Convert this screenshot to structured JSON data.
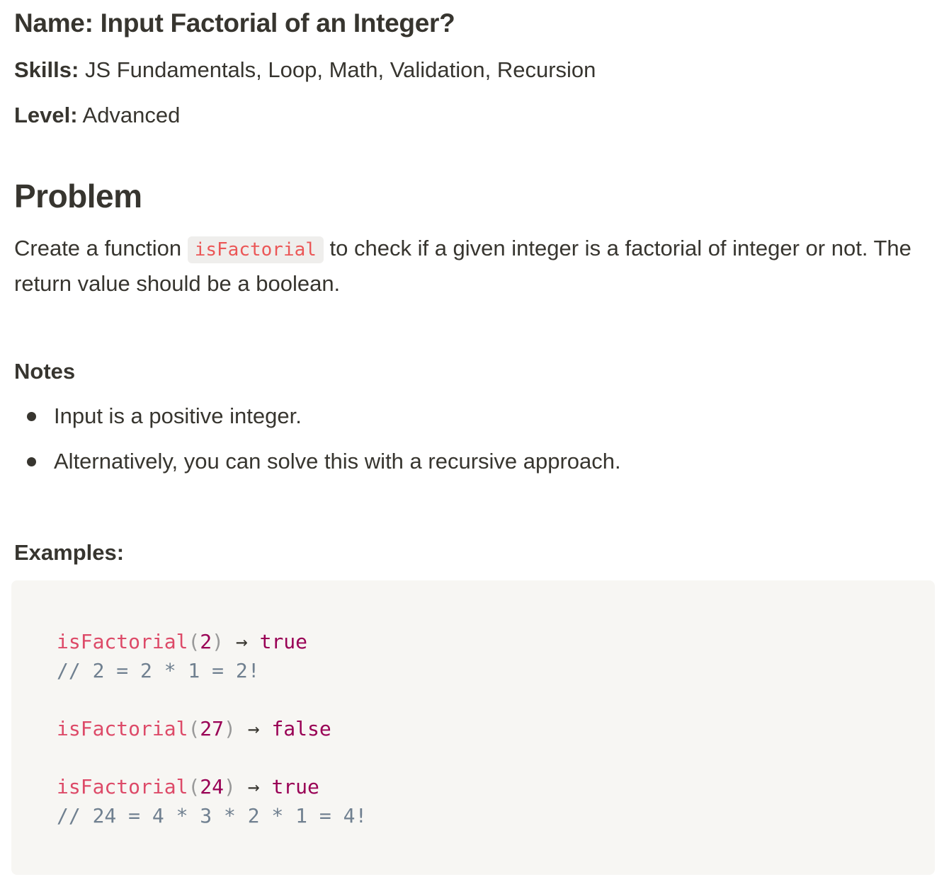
{
  "header": {
    "title": "Name: Input Factorial of an Integer?",
    "skills_label": "Skills:",
    "skills_value": "JS Fundamentals, Loop, Math, Validation, Recursion",
    "level_label": "Level:",
    "level_value": "Advanced"
  },
  "problem": {
    "heading": "Problem",
    "text_before": "Create a function",
    "inline_code": "isFactorial",
    "text_after": "to check if a given integer is a factorial of integer or not. The return value should be a boolean."
  },
  "notes": {
    "heading": "Notes",
    "items": [
      "Input is a positive integer.",
      "Alternatively, you can solve this with a recursive approach."
    ]
  },
  "examples": {
    "heading": "Examples:",
    "code": [
      {
        "fn": "isFactorial",
        "arg": "2",
        "arrow": "→",
        "result": "true",
        "comment": "// 2 = 2 * 1 = 2!"
      },
      {
        "fn": "isFactorial",
        "arg": "27",
        "arrow": "→",
        "result": "false",
        "comment": ""
      },
      {
        "fn": "isFactorial",
        "arg": "24",
        "arrow": "→",
        "result": "true",
        "comment": "// 24 = 4 * 3 * 2 * 1 = 4!"
      }
    ]
  },
  "colors": {
    "text": "#37352f",
    "inline_code_text": "#eb5757",
    "inline_code_bg": "#efeeec",
    "code_block_bg": "#f7f6f3",
    "code_function": "#dd4a68",
    "code_number": "#990055",
    "code_comment": "#708090"
  }
}
